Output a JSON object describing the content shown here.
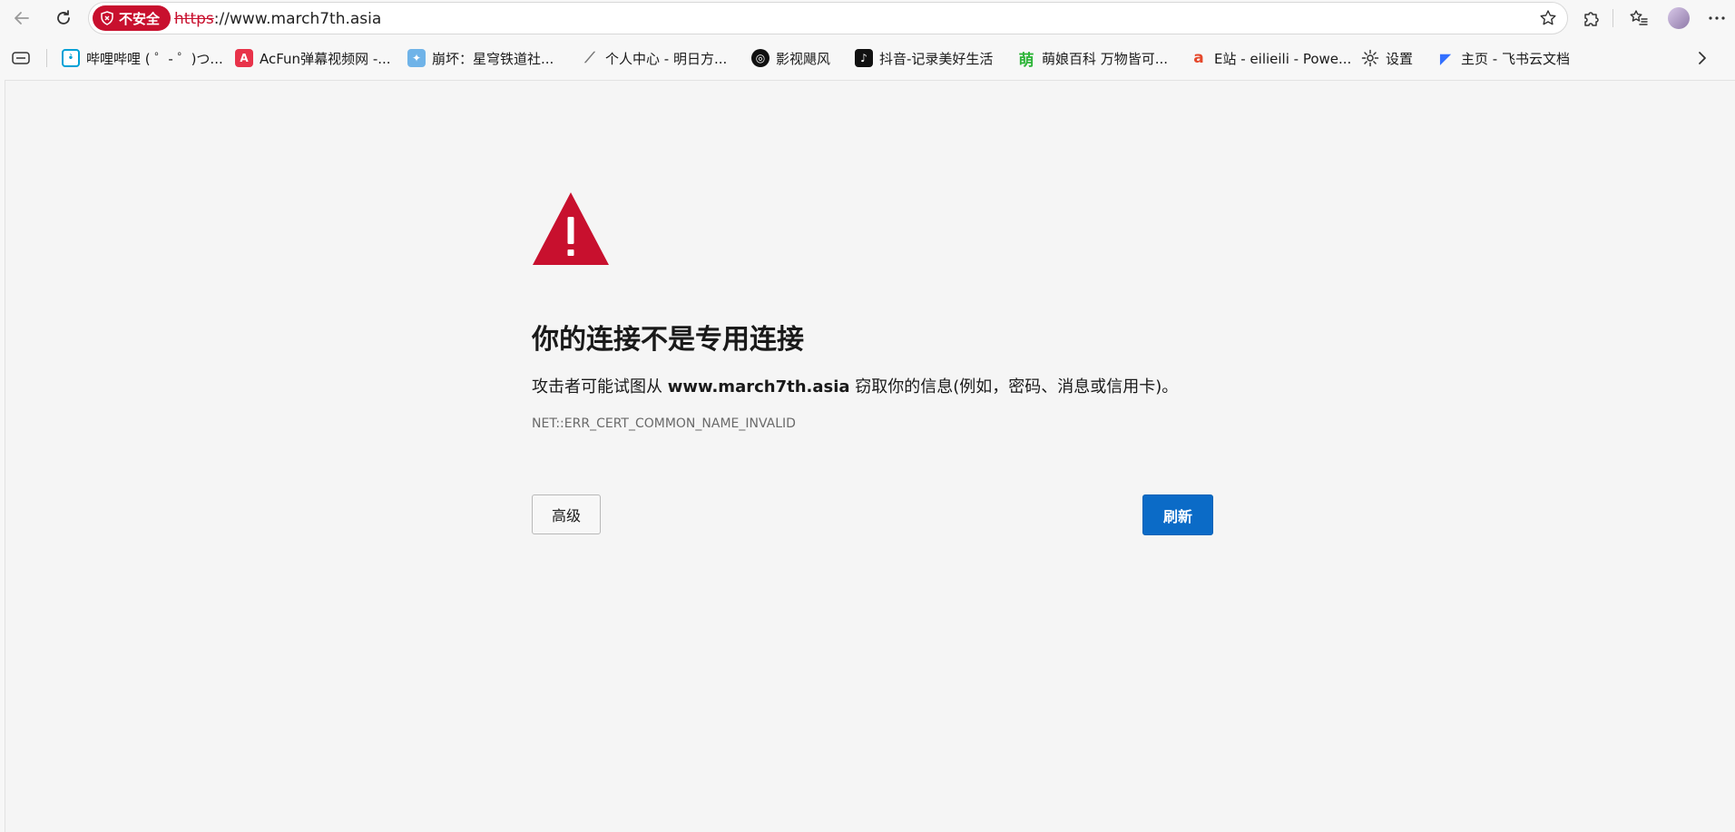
{
  "browser": {
    "address_bar": {
      "security_badge": "不安全",
      "url_scheme": "https",
      "url_rest": "://www.march7th.asia"
    },
    "bookmarks": [
      {
        "label": "哔哩哔哩 ( ゜- ゜)つ...",
        "icon": "bilibili-icon",
        "color": "#00a1d6"
      },
      {
        "label": "AcFun弹幕视频网 -...",
        "icon": "acfun-icon",
        "color": "#e8334a"
      },
      {
        "label": "崩坏：星穹铁道社...",
        "icon": "honkai-icon",
        "color": "#6fb3e8"
      },
      {
        "label": "个人中心 - 明日方...",
        "icon": "arknights-icon",
        "color": "#444444"
      },
      {
        "label": "影视飓风",
        "icon": "mediastorm-icon",
        "color": "#111111"
      },
      {
        "label": "抖音-记录美好生活",
        "icon": "douyin-icon",
        "color": "#111111"
      },
      {
        "label": "萌娘百科 万物皆可...",
        "icon": "moegirl-icon",
        "color": "#2fb53a"
      },
      {
        "label": "E站 - eilieili - Powe...",
        "icon": "estation-icon",
        "color": "#e5482b"
      },
      {
        "label": "设置",
        "icon": "gear-icon",
        "color": "#333333"
      },
      {
        "label": "主页 - 飞书云文档",
        "icon": "feishu-icon",
        "color": "#3370ff"
      }
    ]
  },
  "error_page": {
    "title": "你的连接不是专用连接",
    "desc_prefix": "攻击者可能试图从 ",
    "desc_host": "www.march7th.asia",
    "desc_suffix": " 窃取你的信息(例如，密码、消息或信用卡)。",
    "error_code": "NET::ERR_CERT_COMMON_NAME_INVALID",
    "advanced_label": "高级",
    "refresh_label": "刷新"
  },
  "colors": {
    "danger": "#c8102e",
    "primary_button": "#0b6bc7"
  }
}
